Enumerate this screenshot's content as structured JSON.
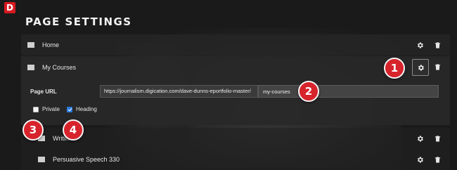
{
  "header": {
    "logo_letter": "D",
    "title": "PAGE SETTINGS"
  },
  "pages": [
    {
      "label": "Home"
    },
    {
      "label": "My Courses"
    },
    {
      "label": "Writin"
    },
    {
      "label": "Persuasive Speech 330"
    }
  ],
  "settings": {
    "url_label": "Page URL",
    "url_base": "https://journalism.digication.com/dave-dunns-eportfolio-master/",
    "url_slug": "my-courses",
    "private_label": "Private",
    "private_checked": false,
    "heading_label": "Heading",
    "heading_checked": true
  },
  "annotations": [
    "1",
    "2",
    "3",
    "4"
  ],
  "colors": {
    "badge": "#d7232b",
    "checkbox_on": "#2d7be0",
    "logo": "#d71920"
  }
}
